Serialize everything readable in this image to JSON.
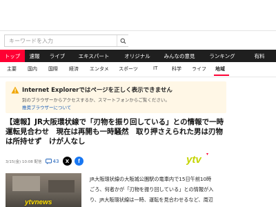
{
  "search": {
    "placeholder": "キーワードを入力"
  },
  "nav": {
    "items": [
      "トップ",
      "速報",
      "ライブ",
      "エキスパート",
      "オリジナル",
      "みんなの意見",
      "ランキング",
      "有料"
    ],
    "active_index": 0,
    "accent_color": "#ff0033"
  },
  "subnav": {
    "items": [
      "主要",
      "国内",
      "国際",
      "経済",
      "エンタメ",
      "スポーツ",
      "IT",
      "科学",
      "ライフ",
      "地域"
    ],
    "active_index": 9
  },
  "ie_notice": {
    "title": "Internet Explorerではページを正しく表示できません",
    "body": "別のブラウザーからアクセスするか、スマートフォンからご覧ください。",
    "link": "推奨ブラウザーについて"
  },
  "article": {
    "headline": "【速報】JR大阪環状線で「刃物を振り回している」との情報で一時運転見合わせ　現在は再開も一時騒然　取り押さえられた男は刃物は所持せず　けが人なし",
    "date": "3/15(金) 10:08 配信",
    "comment_count": "43",
    "source_logo": "ytv",
    "thumbnail_logo": "ytvnews",
    "body_lines": [
      "JR大阪環状線の大阪城公園駅の電車内で15日午前10時",
      "ごろ、何者かが「刃物を振り回している」との情報が入",
      "り、JR大阪環状線は一時、運転を見合わせるなど、周辺"
    ]
  }
}
